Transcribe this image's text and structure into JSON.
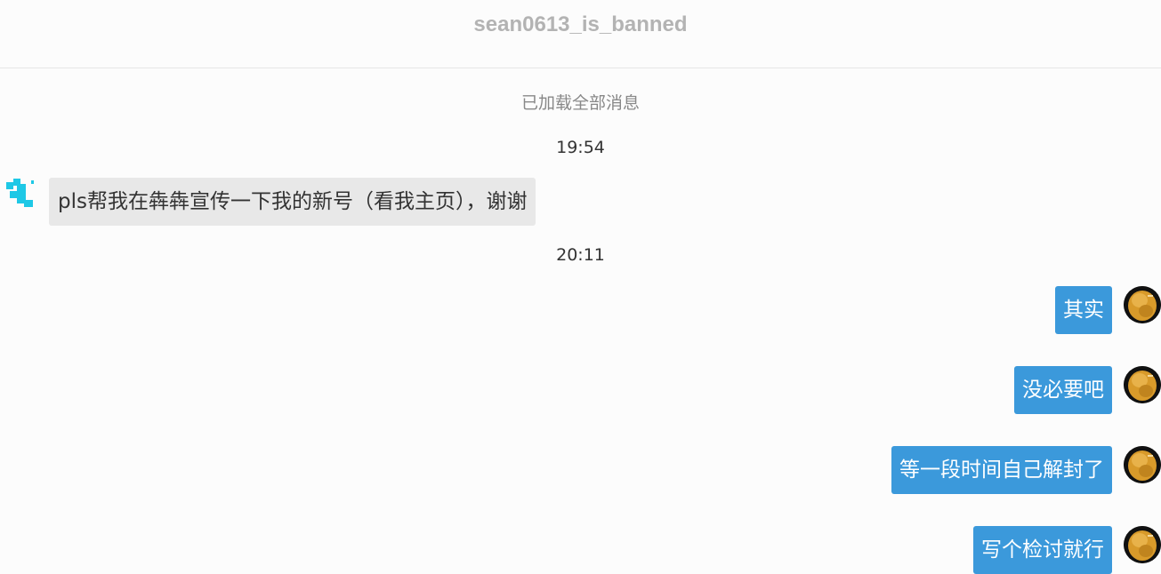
{
  "header": {
    "title": "sean0613_is_banned"
  },
  "system": {
    "all_loaded": "已加载全部消息"
  },
  "timestamps": [
    "19:54",
    "20:11"
  ],
  "messages": {
    "incoming": [
      {
        "text": "pls帮我在犇犇宣传一下我的新号（看我主页），谢谢",
        "avatar": "pixel-avatar-icon"
      }
    ],
    "outgoing": [
      {
        "text": "其实",
        "avatar": "golden-nugget-avatar"
      },
      {
        "text": "没必要吧",
        "avatar": "golden-nugget-avatar"
      },
      {
        "text": "等一段时间自己解封了",
        "avatar": "golden-nugget-avatar"
      },
      {
        "text": "写个检讨就行",
        "avatar": "golden-nugget-avatar"
      }
    ]
  },
  "colors": {
    "outgoing_bubble": "#3b99db",
    "incoming_bubble": "#e8e8e8",
    "title": "#b3b3b3",
    "pixel_avatar": "#1ec8e6"
  }
}
